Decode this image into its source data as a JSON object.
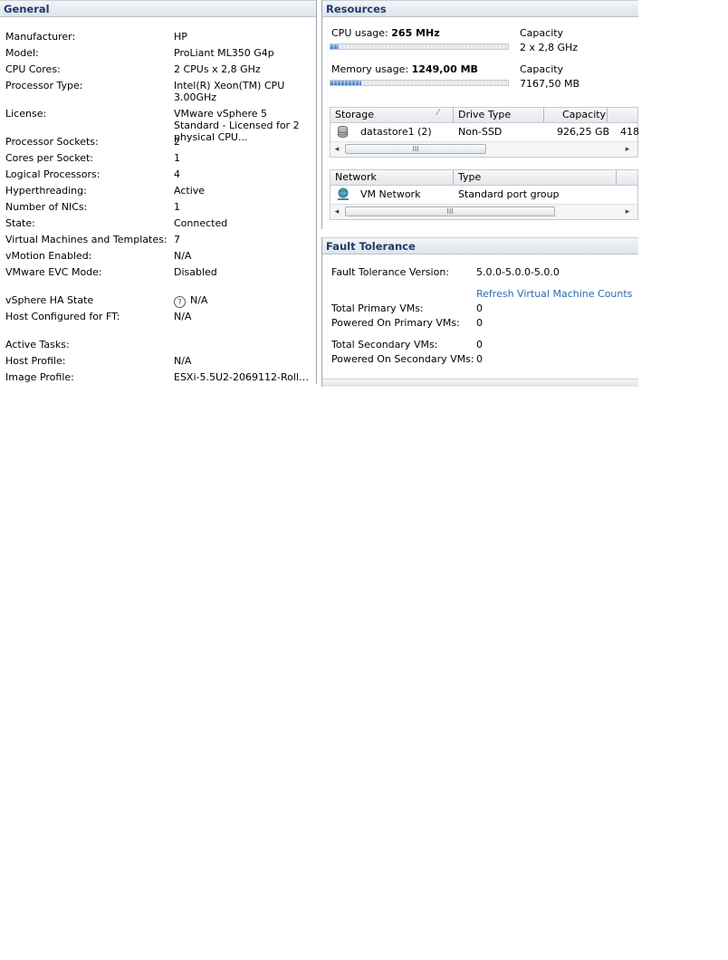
{
  "general": {
    "title": "General",
    "rows": [
      {
        "label": "Manufacturer:",
        "value": "HP"
      },
      {
        "label": "Model:",
        "value": "ProLiant ML350 G4p"
      },
      {
        "label": "CPU Cores:",
        "value": "2 CPUs x 2,8 GHz"
      },
      {
        "label": "Processor Type:",
        "value": "Intel(R) Xeon(TM) CPU 3.00GHz"
      },
      {
        "label": "License:",
        "value": "VMware vSphere 5 Standard - Licensed for 2 physical CPU..."
      },
      {
        "label": "Processor Sockets:",
        "value": "2"
      },
      {
        "label": "Cores per Socket:",
        "value": "1"
      },
      {
        "label": "Logical Processors:",
        "value": "4"
      },
      {
        "label": "Hyperthreading:",
        "value": "Active"
      },
      {
        "label": "Number of NICs:",
        "value": "1"
      },
      {
        "label": "State:",
        "value": "Connected"
      },
      {
        "label": "Virtual Machines and Templates:",
        "value": "7"
      },
      {
        "label": "vMotion Enabled:",
        "value": "N/A"
      },
      {
        "label": "VMware EVC Mode:",
        "value": "Disabled"
      },
      {
        "label": "vSphere HA State",
        "value": "N/A",
        "icon": "help-icon"
      },
      {
        "label": "Host Configured for FT:",
        "value": "N/A"
      },
      {
        "label": "Active Tasks:",
        "value": ""
      },
      {
        "label": "Host Profile:",
        "value": "N/A"
      },
      {
        "label": "Image Profile:",
        "value": "ESXi-5.5U2-2069112-Rollup..."
      }
    ]
  },
  "resources": {
    "title": "Resources",
    "cpu": {
      "label": "CPU usage:",
      "value": "265 MHz",
      "capacity_label": "Capacity",
      "capacity_value": "2 x 2,8 GHz",
      "usage_fraction": 0.045
    },
    "memory": {
      "label": "Memory usage:",
      "value": "1249,00 MB",
      "capacity_label": "Capacity",
      "capacity_value": "7167,50 MB",
      "usage_fraction": 0.174
    },
    "storage_table": {
      "headers": [
        "Storage",
        "Drive Type",
        "Capacity",
        ""
      ],
      "rows": [
        {
          "name": "datastore1 (2)",
          "drive_type": "Non-SSD",
          "capacity": "926,25 GB",
          "extra": "418",
          "icon": "datastore-icon"
        }
      ]
    },
    "network_table": {
      "headers": [
        "Network",
        "Type"
      ],
      "rows": [
        {
          "name": "VM Network",
          "type": "Standard port group",
          "icon": "network-icon"
        }
      ]
    }
  },
  "fault_tolerance": {
    "title": "Fault Tolerance",
    "version_label": "Fault Tolerance Version:",
    "version_value": "5.0.0-5.0.0-5.0.0",
    "refresh_link": "Refresh Virtual Machine Counts",
    "rows": [
      {
        "label": "Total Primary VMs:",
        "value": "0"
      },
      {
        "label": "Powered On Primary VMs:",
        "value": "0"
      },
      {
        "label": "Total Secondary VMs:",
        "value": "0"
      },
      {
        "label": "Powered On Secondary VMs:",
        "value": "0"
      }
    ]
  },
  "icons": {
    "scroll_left": "◂",
    "scroll_right": "▸",
    "grip": "III",
    "sort": "⁄",
    "help": "?"
  }
}
